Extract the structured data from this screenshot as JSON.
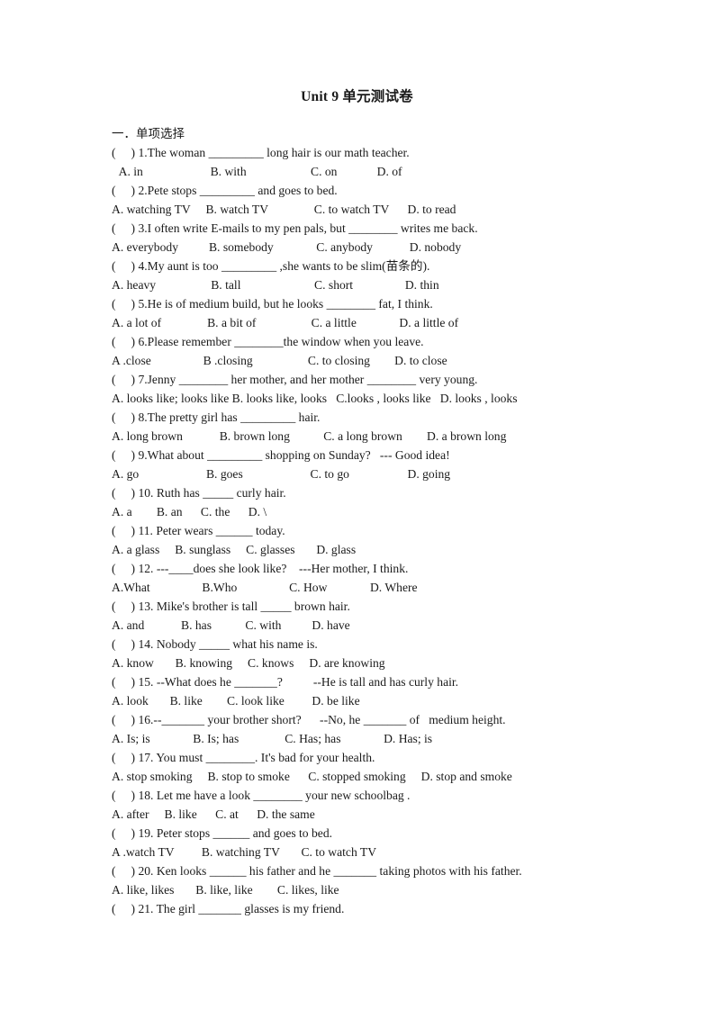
{
  "document": {
    "title": "Unit 9 单元测试卷",
    "section_heading": "一．单项选择"
  },
  "questions": [
    {
      "prompt": "(     ) 1.The woman _________ long hair is our math teacher.",
      "options": " A. in                      B. with                     C. on             D. of",
      "options_indent": true
    },
    {
      "prompt": "(     ) 2.Pete stops _________ and goes to bed.",
      "options": "A. watching TV     B. watch TV               C. to watch TV      D. to read",
      "options_indent": false
    },
    {
      "prompt": "(     ) 3.I often write E-mails to my pen pals, but ________ writes me back.",
      "options": "A. everybody          B. somebody              C. anybody            D. nobody",
      "options_indent": false
    },
    {
      "prompt": "(     ) 4.My aunt is too _________ ,she wants to be slim(苗条的).",
      "options": "A. heavy                  B. tall                        C. short                 D. thin",
      "options_indent": false
    },
    {
      "prompt": "(     ) 5.He is of medium build, but he looks ________ fat, I think.",
      "options": "A. a lot of               B. a bit of                  C. a little              D. a little of",
      "options_indent": false
    },
    {
      "prompt": "(     ) 6.Please remember ________the window when you leave.",
      "options": "A .close                 B .closing                  C. to closing        D. to close",
      "options_indent": false
    },
    {
      "prompt": "(     ) 7.Jenny ________ her mother, and her mother ________ very young.",
      "options": "A. looks like; looks like B. looks like, looks   C.looks , looks like   D. looks , looks",
      "options_indent": false
    },
    {
      "prompt": "(     ) 8.The pretty girl has _________ hair.",
      "options": "A. long brown            B. brown long           C. a long brown        D. a brown long",
      "options_indent": false
    },
    {
      "prompt": "(     ) 9.What about _________ shopping on Sunday?   --- Good idea!",
      "options": "A. go                      B. goes                      C. to go                   D. going",
      "options_indent": false
    },
    {
      "prompt": "(     ) 10. Ruth has _____ curly hair.",
      "options": "A. a        B. an      C. the      D. \\",
      "options_indent": false
    },
    {
      "prompt": "(     ) 11. Peter wears ______ today.",
      "options": "A. a glass     B. sunglass     C. glasses       D. glass",
      "options_indent": false
    },
    {
      "prompt": "(     ) 12. ---____does she look like?    ---Her mother, I think.",
      "options": "A.What                 B.Who                 C. How              D. Where",
      "options_indent": false
    },
    {
      "prompt": "(     ) 13. Mike's brother is tall _____ brown hair.",
      "options": "A. and            B. has           C. with          D. have",
      "options_indent": false
    },
    {
      "prompt": "(     ) 14. Nobody _____ what his name is.",
      "options": "A. know       B. knowing     C. knows     D. are knowing",
      "options_indent": false
    },
    {
      "prompt": "(     ) 15. --What does he _______?          --He is tall and has curly hair.",
      "options": "A. look       B. like        C. look like         D. be like",
      "options_indent": false
    },
    {
      "prompt": "(     ) 16.--_______ your brother short?      --No, he _______ of   medium height.",
      "options": "A. Is; is              B. Is; has               C. Has; has              D. Has; is",
      "options_indent": false
    },
    {
      "prompt": "(     ) 17. You must ________. It's bad for your health.",
      "options": "A. stop smoking     B. stop to smoke      C. stopped smoking     D. stop and smoke",
      "options_indent": false
    },
    {
      "prompt": "(     ) 18. Let me have a look ________ your new schoolbag .",
      "options": "A. after     B. like      C. at      D. the same",
      "options_indent": false
    },
    {
      "prompt": "(     ) 19. Peter stops ______ and goes to bed.",
      "options": "A .watch TV         B. watching TV       C. to watch TV",
      "options_indent": false
    },
    {
      "prompt": "(     ) 20. Ken looks ______ his father and he _______ taking photos with his father.",
      "options": "A. like, likes       B. like, like        C. likes, like",
      "options_indent": false
    },
    {
      "prompt": "(     ) 21. The girl _______ glasses is my friend.",
      "options": "",
      "options_indent": false
    }
  ]
}
